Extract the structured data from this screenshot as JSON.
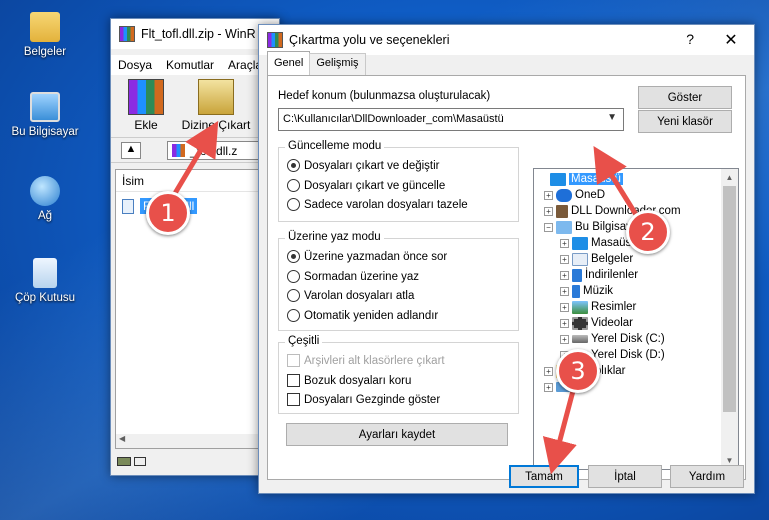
{
  "desktop": {
    "icons": [
      {
        "label": "Belgeler",
        "icon": "documents-folder-icon"
      },
      {
        "label": "Bu Bilgisayar",
        "icon": "this-pc-icon"
      },
      {
        "label": "Ağ",
        "icon": "network-icon"
      },
      {
        "label": "Çöp Kutusu",
        "icon": "recycle-bin-icon"
      }
    ]
  },
  "winrar": {
    "title": "Flt_tofl.dll.zip - WinR",
    "menu": [
      "Dosya",
      "Komutlar",
      "Araçla"
    ],
    "toolbar": {
      "add": "Ekle",
      "extract": "Dizine Çıkart"
    },
    "path": "_tofl.dll.z",
    "column": "İsim",
    "file": "Flt_tofl.dll"
  },
  "dialog": {
    "title": "Çıkartma yolu ve seçenekleri",
    "help": "?",
    "close": "✕",
    "tabs": [
      "Genel",
      "Gelişmiş"
    ],
    "dest_label": "Hedef konum (bulunmazsa oluşturulacak)",
    "dest_value": "C:\\Kullanıcılar\\DllDownloader_com\\Masaüstü",
    "show_btn": "Göster",
    "new_folder_btn": "Yeni klasör",
    "update": {
      "title": "Güncelleme modu",
      "options": [
        "Dosyaları çıkart ve değiştir",
        "Dosyaları çıkart ve güncelle",
        "Sadece varolan dosyaları tazele"
      ],
      "selected": 0
    },
    "overwrite": {
      "title": "Üzerine yaz modu",
      "options": [
        "Üzerine yazmadan önce sor",
        "Sormadan üzerine yaz",
        "Varolan dosyaları atla",
        "Otomatik yeniden adlandır"
      ],
      "selected": 0
    },
    "misc": {
      "title": "Çeşitli",
      "options": [
        "Arşivleri alt klasörlere çıkart",
        "Bozuk dosyaları koru",
        "Dosyaları Gezginde göster"
      ]
    },
    "save_btn": "Ayarları kaydet",
    "tree": [
      "Masaüstü",
      "OneD",
      "DLL Downloader.com",
      "Bu Bilgisaya",
      "Masaüstü",
      "Belgeler",
      "İndirilenler",
      "Müzik",
      "Resimler",
      "Videolar",
      "Yerel Disk (C:)",
      "Yerel Disk (D:)",
      "Kitaplıklar",
      ""
    ],
    "ok": "Tamam",
    "cancel": "İptal",
    "help_btn": "Yardım"
  },
  "steps": [
    "1",
    "2",
    "3"
  ],
  "colors": {
    "accent": "#0078d7",
    "badge": "#e8504a"
  }
}
